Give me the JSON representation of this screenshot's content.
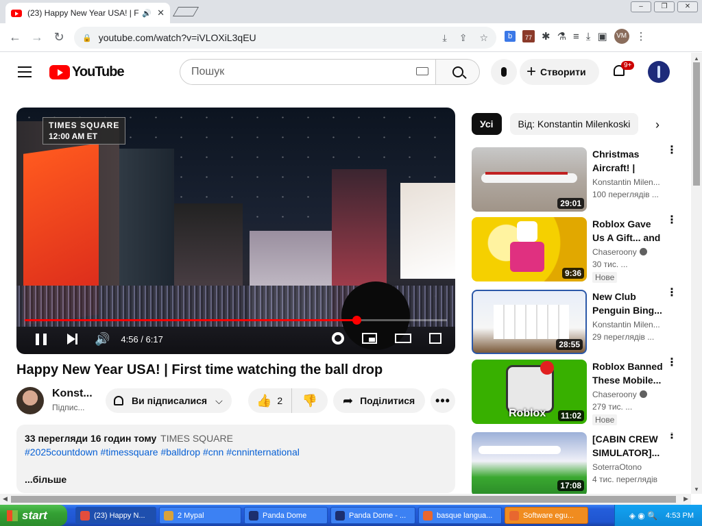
{
  "browser": {
    "tab_title": "(23) Happy New Year USA! | Fi",
    "url": "youtube.com/watch?v=iVLOXiL3qEU",
    "window_controls": [
      "–",
      "❐",
      "✕"
    ],
    "profile_initials": "VM",
    "extension_calendar_day": "77"
  },
  "header": {
    "logo_text": "YouTube",
    "search_placeholder": "Пошук",
    "create_label": "Створити",
    "notifications_badge": "9+"
  },
  "player": {
    "overlay_line1": "TIMES SQUARE",
    "overlay_line2": "12:00 AM ET",
    "time": "4:56 / 6:17",
    "progress_fraction": 0.786
  },
  "video": {
    "title": "Happy New Year USA! | First time watching the ball drop",
    "channel_name": "Konst...",
    "channel_subs": "Підпис...",
    "subscribed_label": "Ви підписалися",
    "likes": "2",
    "share_label": "Поділитися"
  },
  "description": {
    "meta": "33 перегляди  16 годин тому",
    "location_tag": "TIMES SQUARE",
    "hashtags": "#2025countdown #timessquare #balldrop #cnn #cnninternational",
    "more": "...більше"
  },
  "chips": [
    "Усі",
    "Від: Konstantin Milenkoski"
  ],
  "recommendations": [
    {
      "title": "Christmas Aircraft! | Wor...",
      "channel": "Konstantin Milen...",
      "views": "100 переглядів ...",
      "duration": "29:01",
      "verified": false,
      "badge": ""
    },
    {
      "title": "Roblox Gave Us A Gift... and it...",
      "channel": "Chaseroony",
      "views": "30 тис. ...",
      "duration": "9:36",
      "verified": true,
      "badge": "Нове"
    },
    {
      "title": "New Club Penguin Bing...",
      "channel": "Konstantin Milen...",
      "views": "29 переглядів ...",
      "duration": "28:55",
      "verified": false,
      "badge": ""
    },
    {
      "title": "Roblox Banned These Mobile...",
      "channel": "Chaseroony",
      "views": "279 тис. ...",
      "duration": "11:02",
      "verified": true,
      "badge": "Нове",
      "thumb_text": "Roblox"
    },
    {
      "title": "[CABIN CREW SIMULATOR]...",
      "channel": "SoterraOtono",
      "views": "4 тис. переглядів",
      "duration": "17:08",
      "verified": false,
      "badge": ""
    }
  ],
  "taskbar": {
    "start_label": "start",
    "tasks": [
      {
        "label": "(23) Happy N...",
        "active": true,
        "highlight": false,
        "icon_color": "#e34d3c"
      },
      {
        "label": "2 Mypal",
        "active": false,
        "highlight": false,
        "icon_color": "#d9a23a"
      },
      {
        "label": "Panda Dome",
        "active": false,
        "highlight": false,
        "icon_color": "#1c2f6e"
      },
      {
        "label": "Panda Dome - ...",
        "active": false,
        "highlight": false,
        "icon_color": "#1c2f6e"
      },
      {
        "label": "basque langua...",
        "active": false,
        "highlight": false,
        "icon_color": "#e8672f"
      },
      {
        "label": "Software egu...",
        "active": false,
        "highlight": true,
        "icon_color": "#e8672f"
      }
    ],
    "clock": "4:53 PM"
  }
}
